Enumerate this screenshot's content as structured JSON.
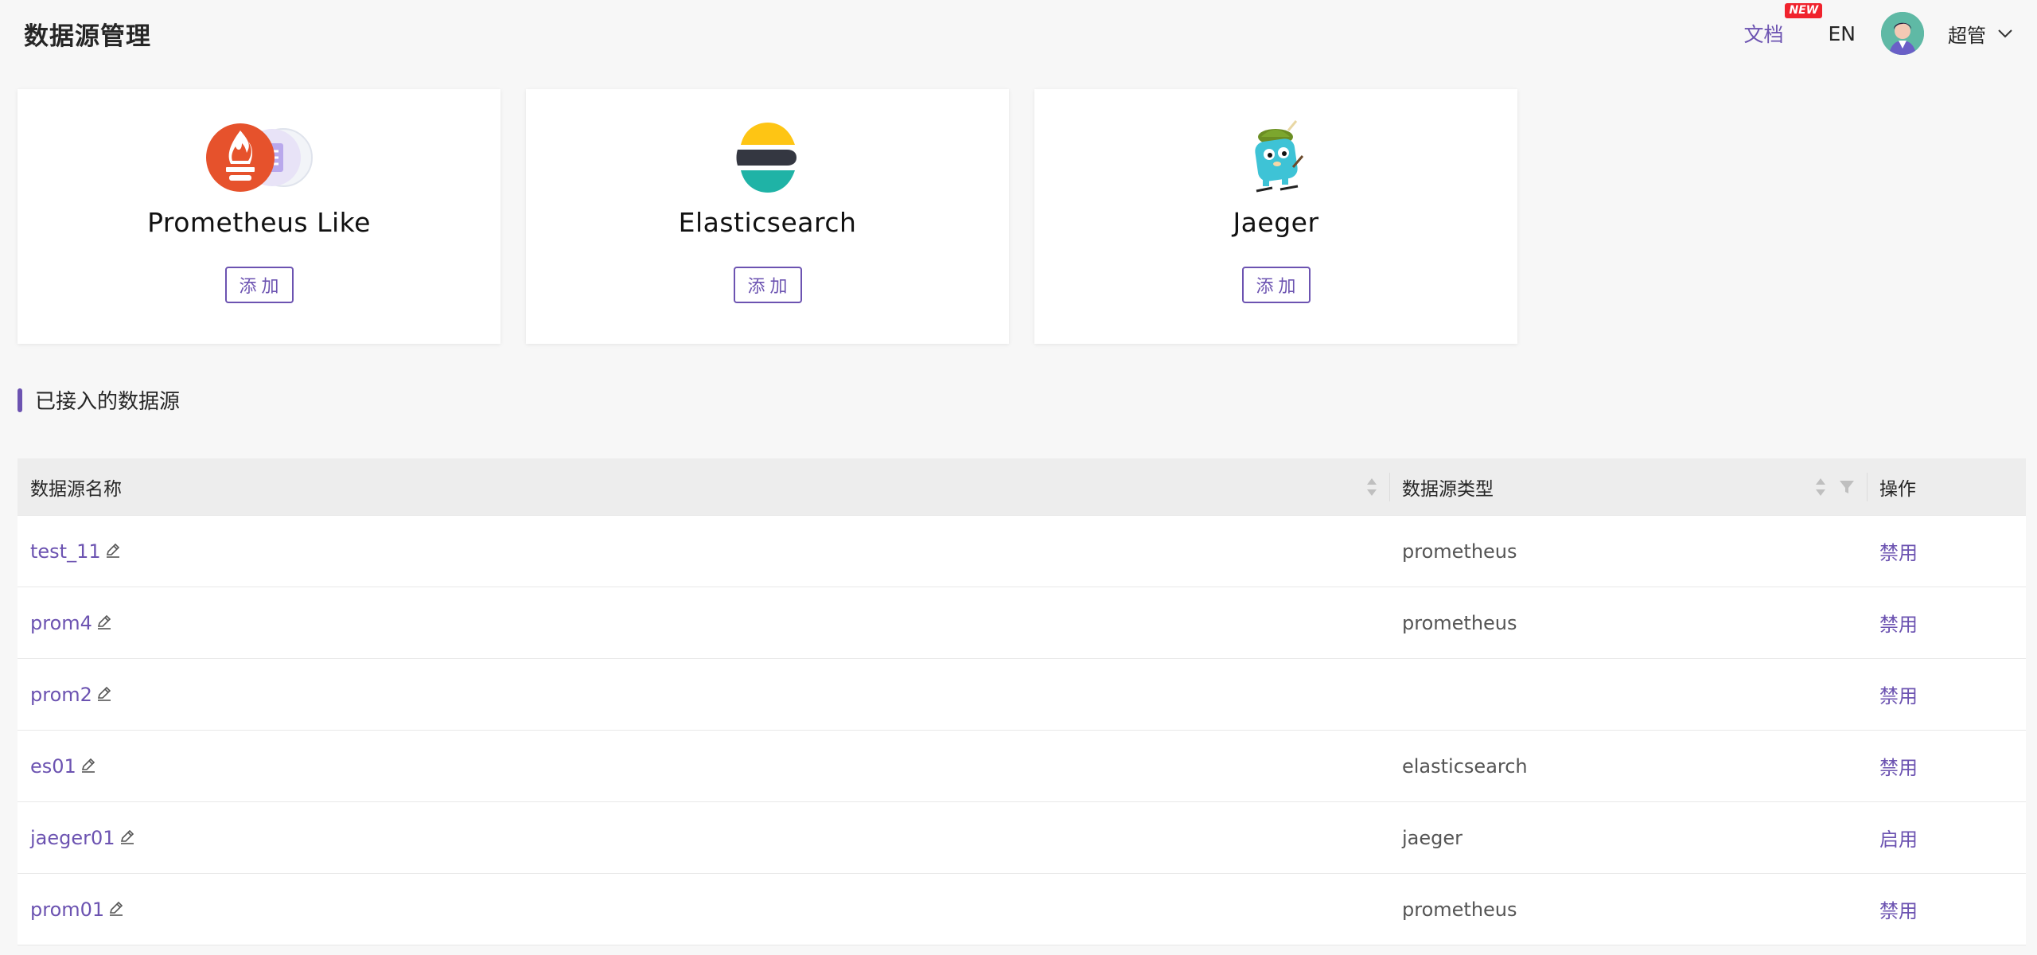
{
  "header": {
    "title": "数据源管理",
    "docs_label": "文档",
    "new_badge": "NEW",
    "lang_label": "EN",
    "user_name": "超管"
  },
  "cards": [
    {
      "title": "Prometheus Like",
      "button": "添加",
      "logo": "prometheus-logo"
    },
    {
      "title": "Elasticsearch",
      "button": "添加",
      "logo": "elasticsearch-logo"
    },
    {
      "title": "Jaeger",
      "button": "添加",
      "logo": "jaeger-logo"
    }
  ],
  "section": {
    "title": "已接入的数据源"
  },
  "table": {
    "columns": [
      "数据源名称",
      "数据源类型",
      "操作"
    ],
    "rows": [
      {
        "name": "test_11",
        "type": "prometheus",
        "action": "禁用"
      },
      {
        "name": "prom4",
        "type": "prometheus",
        "action": "禁用"
      },
      {
        "name": "prom2",
        "type": "",
        "action": "禁用"
      },
      {
        "name": "es01",
        "type": "elasticsearch",
        "action": "禁用"
      },
      {
        "name": "jaeger01",
        "type": "jaeger",
        "action": "启用"
      },
      {
        "name": "prom01",
        "type": "prometheus",
        "action": "禁用"
      }
    ]
  },
  "colors": {
    "accent": "#6c53b1",
    "badge": "#f0232d",
    "background": "#f7f7f7"
  },
  "icons": [
    "edit-icon",
    "sort-icon",
    "filter-icon",
    "chevron-down-icon",
    "avatar"
  ]
}
